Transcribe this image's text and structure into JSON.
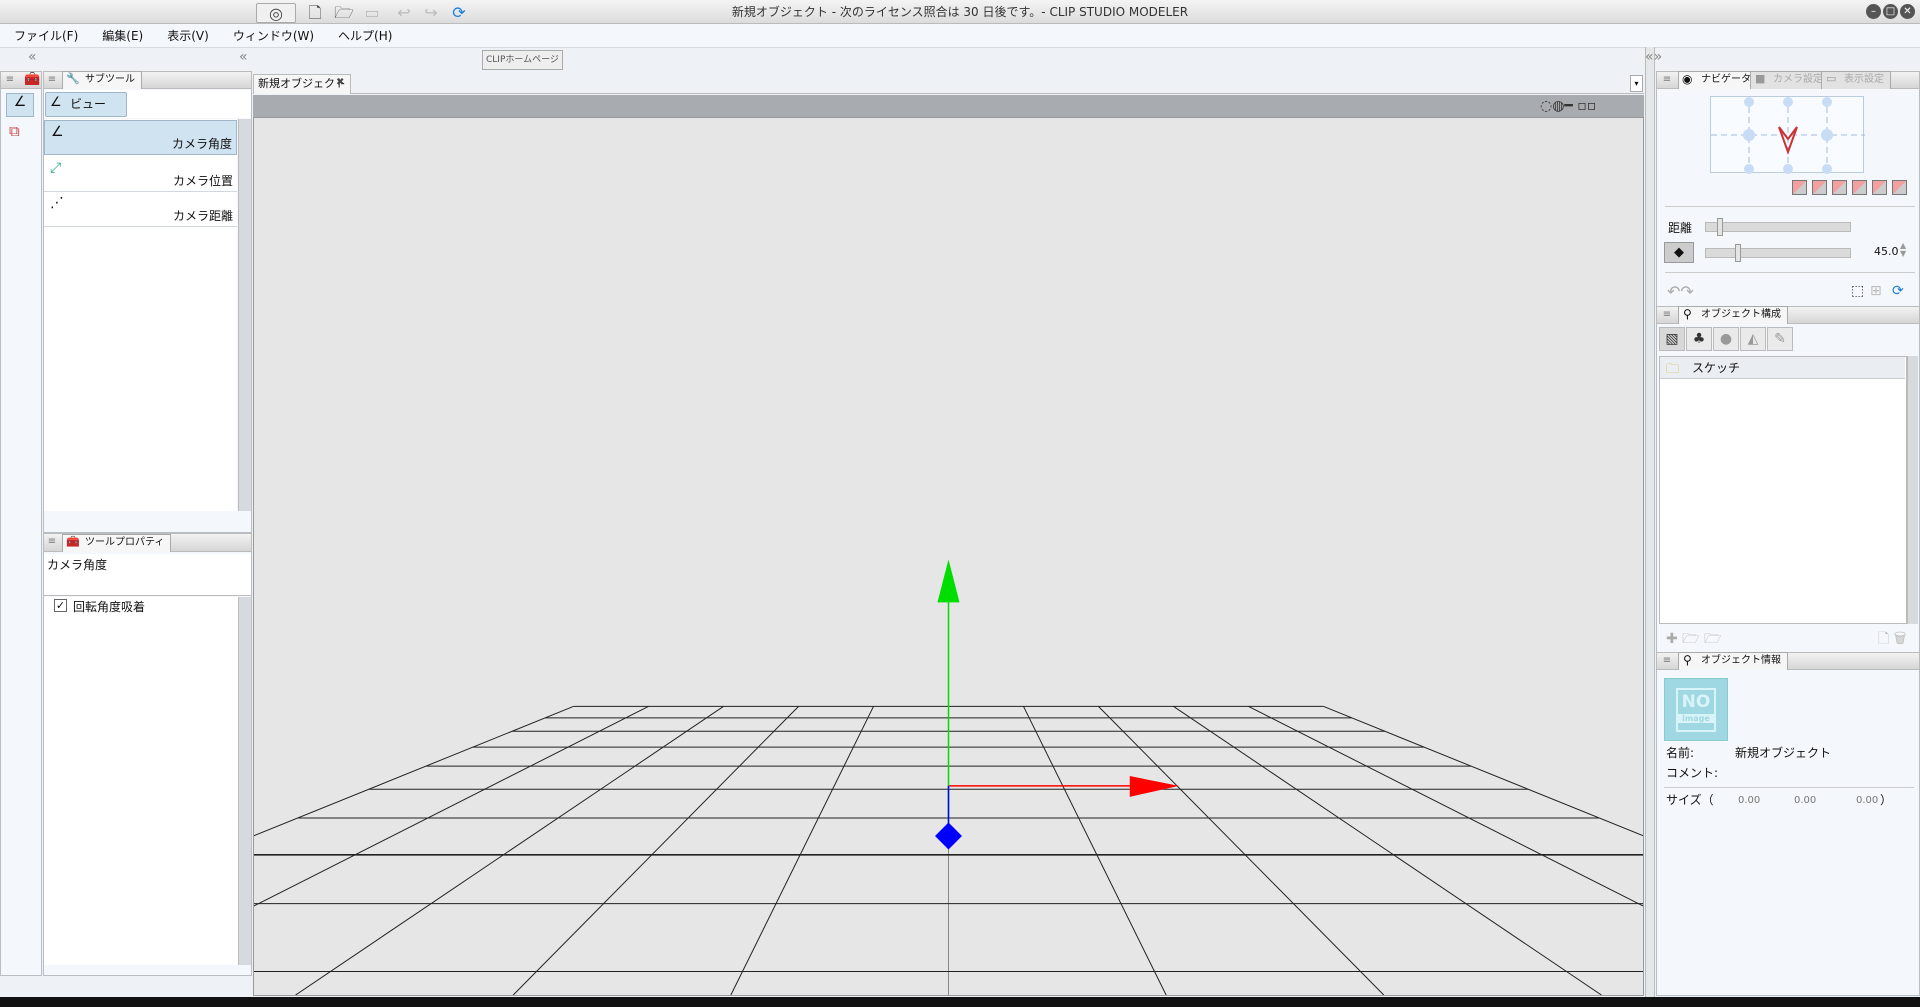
{
  "window": {
    "title": "新規オブジェクト  - 次のライセンス照合は 30 日後です。- CLIP STUDIO MODELER"
  },
  "menu": [
    "ファイル(F)",
    "編集(E)",
    "表示(V)",
    "ウィンドウ(W)",
    "ヘルプ(H)"
  ],
  "toolbar": {
    "home_label": "CLIPホームページ"
  },
  "document": {
    "tab_label": "新規オブジェクト",
    "close": "✖"
  },
  "subtool": {
    "tab_label": "サブツール",
    "group_label": "ビュー",
    "items": [
      {
        "label": "カメラ角度",
        "selected": true
      },
      {
        "label": "カメラ位置",
        "selected": false
      },
      {
        "label": "カメラ距離",
        "selected": false
      }
    ]
  },
  "tool_property": {
    "tab_label": "ツールプロパティ",
    "title": "カメラ角度",
    "checkbox_label": "回転角度吸着",
    "checkbox_checked": true
  },
  "navigator": {
    "tabs": [
      "ナビゲーター",
      "カメラ設定",
      "表示設定"
    ],
    "distance_label": "距離",
    "distance_value": 0.08,
    "angle_value": "45.0",
    "angle_slider": 0.2
  },
  "object_composition": {
    "tab_label": "オブジェクト構成",
    "items": [
      "スケッチ"
    ]
  },
  "object_info": {
    "tab_label": "オブジェクト情報",
    "no_image_text": "NO",
    "no_image_sub": "image",
    "name_label": "名前:",
    "name_value": "新規オブジェクト",
    "comment_label": "コメント:",
    "size_label": "サイズ（",
    "size_values": [
      "0.00",
      "0.00",
      "0.00"
    ],
    "size_close": "）"
  },
  "colors": {
    "x_axis": "#ff0000",
    "y_axis": "#00dd00",
    "z_axis": "#0000ff",
    "viewport_bg": "#e6e6e6"
  }
}
